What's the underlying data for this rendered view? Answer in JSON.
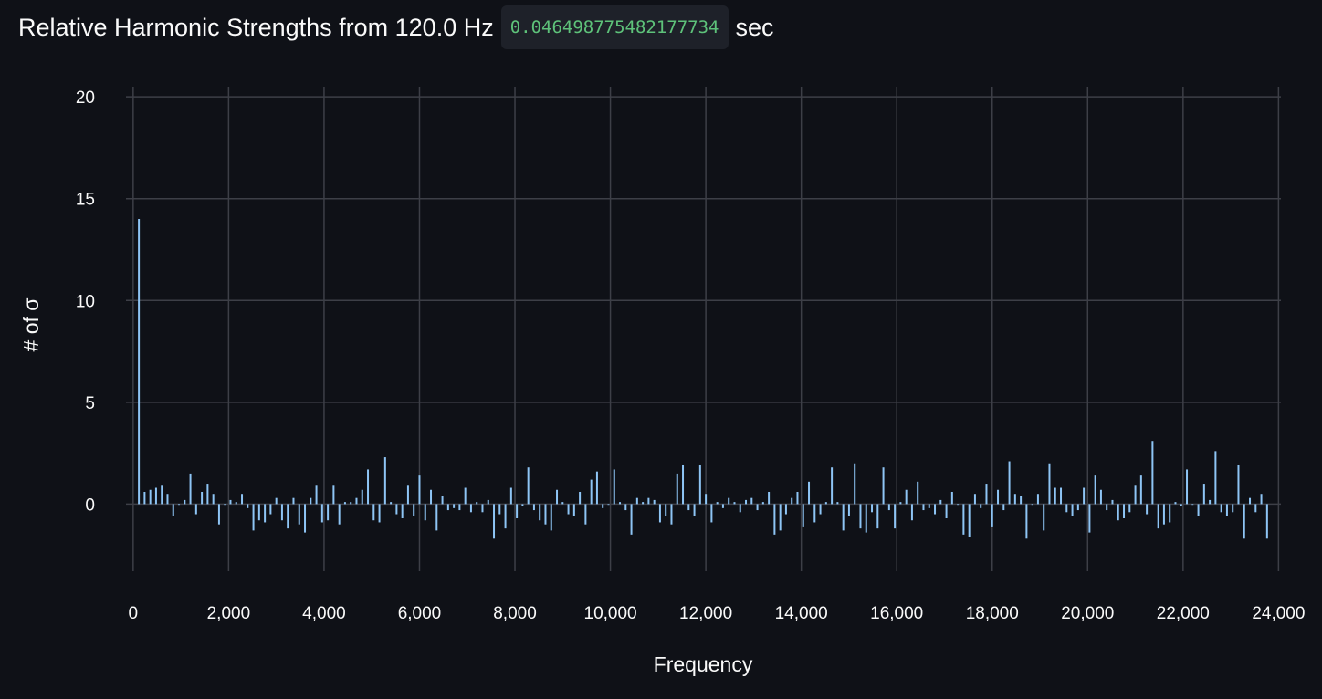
{
  "header": {
    "title_prefix": "Relative Harmonic Strengths from 120.0 Hz",
    "time_value": "0.046498775482177734",
    "time_unit": "sec"
  },
  "chart_data": {
    "type": "bar",
    "title": "Relative Harmonic Strengths from 120.0 Hz",
    "xlabel": "Frequency",
    "ylabel": "# of σ",
    "xlim": [
      -150,
      24050
    ],
    "ylim": [
      -3.3,
      20.5
    ],
    "xticks": [
      0,
      2000,
      4000,
      6000,
      8000,
      10000,
      12000,
      14000,
      16000,
      18000,
      20000,
      22000,
      24000
    ],
    "xtick_labels": [
      "0",
      "2,000",
      "4,000",
      "6,000",
      "8,000",
      "10,000",
      "12,000",
      "14,000",
      "16,000",
      "18,000",
      "20,000",
      "22,000",
      "24,000"
    ],
    "yticks": [
      0,
      5,
      10,
      15,
      20
    ],
    "ytick_labels": [
      "0",
      "5",
      "10",
      "15",
      "20"
    ],
    "grid": true,
    "color": "#8ec5f5",
    "x_start": 120,
    "x_step": 120,
    "values": [
      14.0,
      0.6,
      0.7,
      0.8,
      0.9,
      0.5,
      -0.6,
      0.0,
      0.2,
      1.5,
      -0.5,
      0.6,
      1.0,
      0.5,
      -1.0,
      0.0,
      0.2,
      0.1,
      0.5,
      -0.2,
      -1.3,
      -0.8,
      -0.9,
      -0.5,
      0.3,
      -0.8,
      -1.2,
      0.3,
      -1.0,
      -1.4,
      0.3,
      0.9,
      -0.9,
      -0.8,
      0.9,
      -1.0,
      0.1,
      0.1,
      0.3,
      0.7,
      1.7,
      -0.8,
      -0.9,
      2.3,
      0.1,
      -0.5,
      -0.7,
      0.9,
      -0.6,
      1.4,
      -0.8,
      0.7,
      -1.3,
      0.4,
      -0.3,
      -0.2,
      -0.3,
      0.8,
      -0.4,
      0.1,
      -0.4,
      0.2,
      -1.7,
      -0.5,
      -1.2,
      0.8,
      -0.7,
      -0.1,
      1.8,
      -0.3,
      -0.8,
      -1.0,
      -1.3,
      0.7,
      0.1,
      -0.5,
      -0.6,
      0.6,
      -1.0,
      1.2,
      1.6,
      -0.2,
      0.0,
      1.7,
      0.1,
      -0.3,
      -1.5,
      0.3,
      0.1,
      0.3,
      0.2,
      -0.9,
      -0.6,
      -1.0,
      1.5,
      1.9,
      -0.3,
      -0.6,
      1.9,
      0.5,
      -0.9,
      0.1,
      -0.2,
      0.3,
      0.1,
      -0.4,
      0.2,
      0.3,
      -0.3,
      0.1,
      0.6,
      -1.5,
      -1.3,
      -0.5,
      0.3,
      0.6,
      -1.1,
      1.1,
      -0.9,
      -0.5,
      0.1,
      1.8,
      0.1,
      -1.3,
      -0.6,
      2.0,
      -1.2,
      -1.4,
      -0.4,
      -1.2,
      1.8,
      -0.3,
      -1.2,
      0.1,
      0.7,
      -0.8,
      1.1,
      -0.3,
      -0.2,
      -0.5,
      0.2,
      -0.7,
      0.6,
      0.0,
      -1.5,
      -1.6,
      0.5,
      -0.2,
      1.0,
      -1.1,
      0.7,
      -0.3,
      2.1,
      0.5,
      0.4,
      -1.7,
      0.0,
      0.5,
      -1.3,
      2.0,
      0.8,
      0.8,
      -0.4,
      -0.6,
      -0.3,
      0.8,
      -1.4,
      1.4,
      0.7,
      -0.3,
      0.2,
      -0.8,
      -0.7,
      -0.4,
      0.9,
      1.4,
      -0.5,
      3.1,
      -1.2,
      -1.0,
      -0.9,
      0.1,
      -0.1,
      1.7,
      0.0,
      -0.6,
      1.0,
      0.2,
      2.6,
      -0.4,
      -0.6,
      -0.4,
      1.9,
      -1.7,
      0.3,
      -0.4,
      0.5,
      -1.7
    ]
  }
}
